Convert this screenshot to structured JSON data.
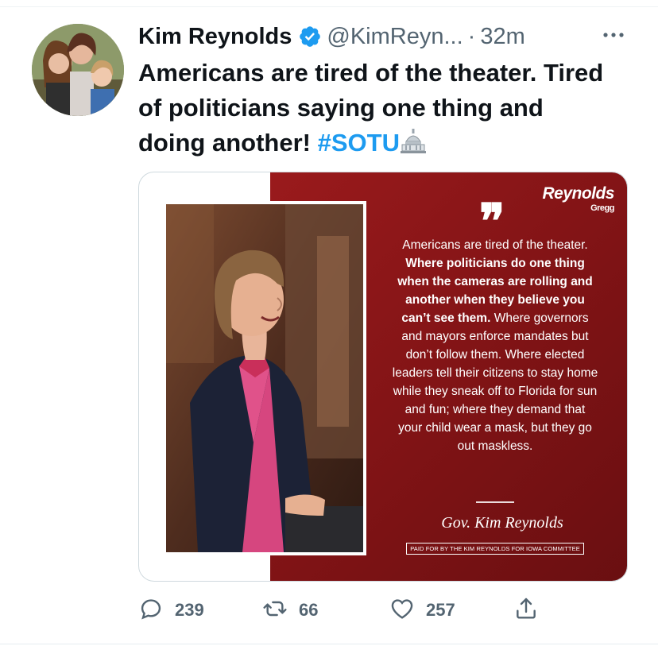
{
  "tweet": {
    "author_name": "Kim Reynolds",
    "handle": "@KimReyn...",
    "separator": "·",
    "time": "32m",
    "text_main": "Americans are tired of the theater. Tired of politicians saying one thing and doing another!",
    "hashtag": "#SOTU",
    "icons": {
      "verified": "verified-badge-icon",
      "more": "more-options-icon",
      "capitol": "capitol-emoji-icon"
    },
    "colors": {
      "accent": "#1d9bf0",
      "text": "#0f1419",
      "muted": "#536471",
      "panel_red": "#8a1416"
    }
  },
  "media": {
    "brand_name": "Reynolds",
    "brand_sub": "Gregg",
    "quote_mark": "❞",
    "quote_plain_1": "Americans are tired of the theater.",
    "quote_bold": "Where politicians do one thing when the cameras are rolling and another when they believe you can’t see them.",
    "quote_plain_2": "Where governors and mayors enforce mandates but don’t follow them. Where elected leaders tell their citizens to stay home while they sneak off to Florida for sun and fun; where they demand that your child wear a mask, but they go out maskless.",
    "signature": "Gov. Kim Reynolds",
    "paid_for": "PAID FOR BY THE KIM REYNOLDS FOR IOWA COMMITTEE"
  },
  "actions": {
    "reply_count": "239",
    "retweet_count": "66",
    "like_count": "257",
    "icons": [
      "reply-icon",
      "retweet-icon",
      "like-icon",
      "share-icon"
    ]
  }
}
